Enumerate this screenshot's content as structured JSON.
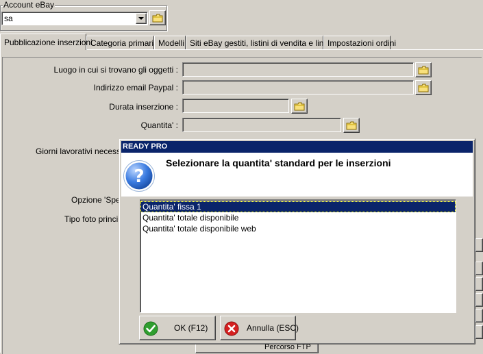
{
  "account": {
    "group_label": "Account eBay",
    "value": "sa"
  },
  "tabs": [
    {
      "label": "Pubblicazione inserzioni",
      "active": true
    },
    {
      "label": "Categoria primaria",
      "active": false
    },
    {
      "label": "Modelli",
      "active": false
    },
    {
      "label": "Siti eBay gestiti, listini di vendita e lingue",
      "active": false
    },
    {
      "label": "Impostazioni ordini",
      "active": false
    }
  ],
  "form": {
    "location_label": "Luogo in cui si trovano gli oggetti :",
    "paypal_label": "Indirizzo email Paypal :",
    "duration_label": "Durata inserzione :",
    "quantity_label": "Quantita' :",
    "working_days_label": "Giorni lavorativi necessari",
    "shipping_option_label": "Opzione 'Sped",
    "photo_type_label": "Tipo foto principa",
    "partial_button_label": "Percorso FTP"
  },
  "dialog": {
    "title": "READY PRO",
    "message": "Selezionare la quantita' standard per le inserzioni",
    "options": [
      "Quantita' fissa 1",
      "Quantita' totale disponibile",
      "Quantita' totale disponibile web"
    ],
    "selected_index": 0,
    "ok_label": "OK (F12)",
    "cancel_label": "Annulla (ESC)"
  },
  "colors": {
    "face": "#d4d0c8",
    "titlebar": "#0a246a",
    "selection": "#0a246a",
    "ok_green": "#2f9e2f",
    "cancel_red": "#d42020"
  }
}
